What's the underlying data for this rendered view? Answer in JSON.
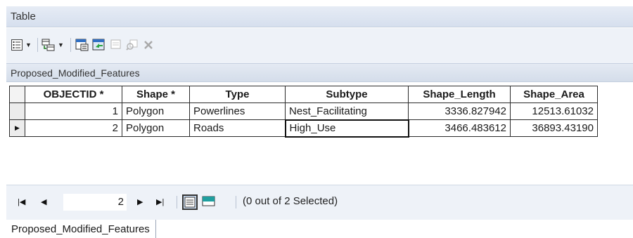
{
  "window": {
    "title": "Table"
  },
  "layer": {
    "name": "Proposed_Modified_Features"
  },
  "toolbar": {
    "icons": [
      "table-options-icon",
      "related-tables-icon",
      "select-by-attributes-icon",
      "switch-selection-icon",
      "clear-selection-icon",
      "zoom-to-selected-icon",
      "delete-selected-icon"
    ]
  },
  "table": {
    "columns": [
      "OBJECTID *",
      "Shape *",
      "Type",
      "Subtype",
      "Shape_Length",
      "Shape_Area"
    ],
    "rows": [
      [
        "1",
        "Polygon",
        "Powerlines",
        "Nest_Facilitating",
        "3336.827942",
        "12513.61032"
      ],
      [
        "2",
        "Polygon",
        "Roads",
        "High_Use",
        "3466.483612",
        "36893.43190"
      ]
    ],
    "current_row": 2
  },
  "navigation": {
    "current_record": "2",
    "selection_text": "(0 out of 2 Selected)"
  },
  "tabs": [
    "Proposed_Modified_Features"
  ]
}
